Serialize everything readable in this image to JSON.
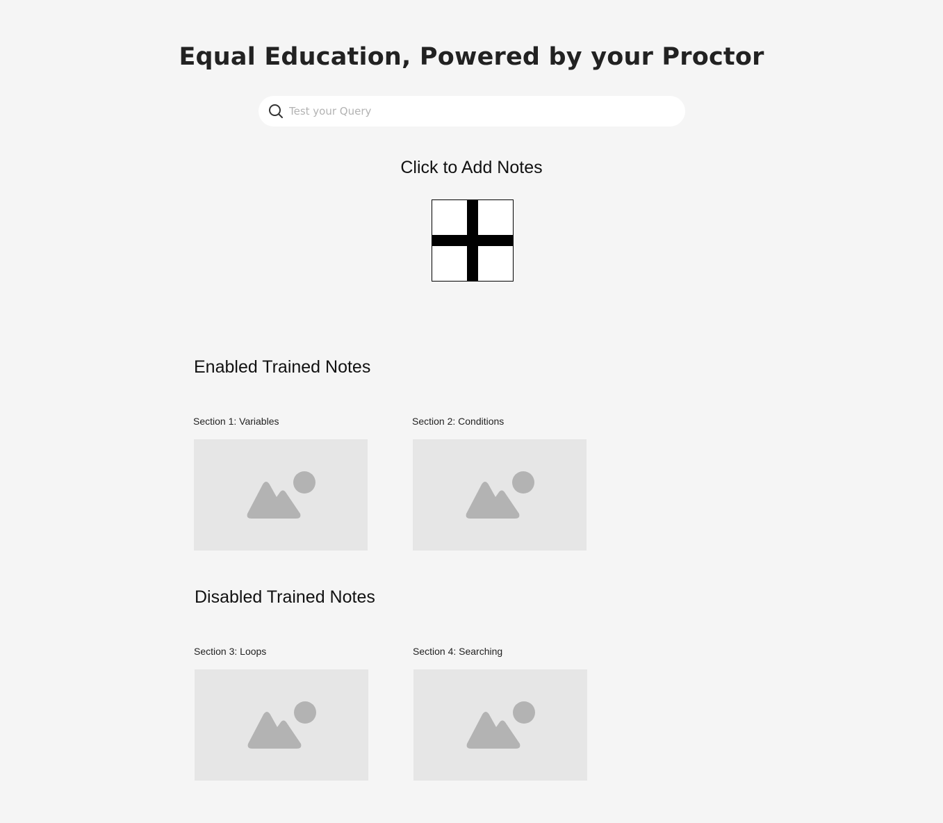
{
  "header": {
    "title": "Equal Education, Powered by your Proctor"
  },
  "search": {
    "placeholder": "Test your Query",
    "value": ""
  },
  "add_notes": {
    "label": "Click to Add Notes",
    "icon": "plus-icon"
  },
  "enabled_section": {
    "heading": "Enabled Trained Notes",
    "notes": [
      {
        "title": "Section 1: Variables",
        "thumbnail_icon": "image-placeholder-icon"
      },
      {
        "title": "Section 2: Conditions",
        "thumbnail_icon": "image-placeholder-icon"
      }
    ]
  },
  "disabled_section": {
    "heading": "Disabled Trained Notes",
    "notes": [
      {
        "title": "Section 3: Loops",
        "thumbnail_icon": "image-placeholder-icon"
      },
      {
        "title": "Section 4: Searching",
        "thumbnail_icon": "image-placeholder-icon"
      }
    ]
  },
  "colors": {
    "page_background": "#f5f5f5",
    "search_background": "#ffffff",
    "thumbnail_background": "#e6e6e6",
    "thumbnail_icon": "#b3b3b3",
    "title_text": "#222222"
  }
}
